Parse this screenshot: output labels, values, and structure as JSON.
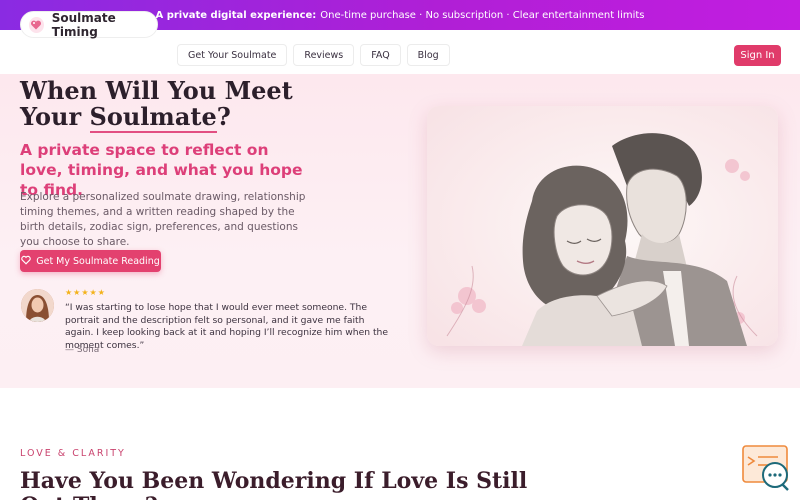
{
  "topbar": {
    "bold": "A private digital experience:",
    "text": "One-time purchase · No subscription · Clear entertainment limits"
  },
  "nav": {
    "brand": "Soulmate Timing",
    "links": [
      "Get Your Soulmate",
      "Reviews",
      "FAQ",
      "Blog"
    ],
    "signin": "Sign In"
  },
  "hero": {
    "title_a": "When Will You Meet",
    "title_b": "Your ",
    "title_u": "Soulmate",
    "title_q": "?",
    "subtitle": "A private space to reflect on love, timing, and what you hope to find.",
    "description": "Explore a personalized soulmate drawing, relationship timing themes, and a written reading shaped by the birth details, zodiac sign, preferences, and questions you choose to share.",
    "cta": "Get My Soulmate Reading",
    "stars": "★★★★★",
    "quote": "“I was starting to lose hope that I would ever meet someone. The portrait and the description felt so personal, and it gave me faith again. I keep looking back at it and hoping I’ll recognize him when the moment comes.”",
    "author": "— Sofia"
  },
  "section": {
    "eyebrow": "LOVE & CLARITY",
    "title": "Have You Been Wondering If Love Is Still",
    "title_2": "Out There?"
  },
  "colors": {
    "accent": "#e3416f",
    "topbar_from": "#8a2be2",
    "topbar_to": "#c21ee0",
    "star": "#f3b21a"
  }
}
